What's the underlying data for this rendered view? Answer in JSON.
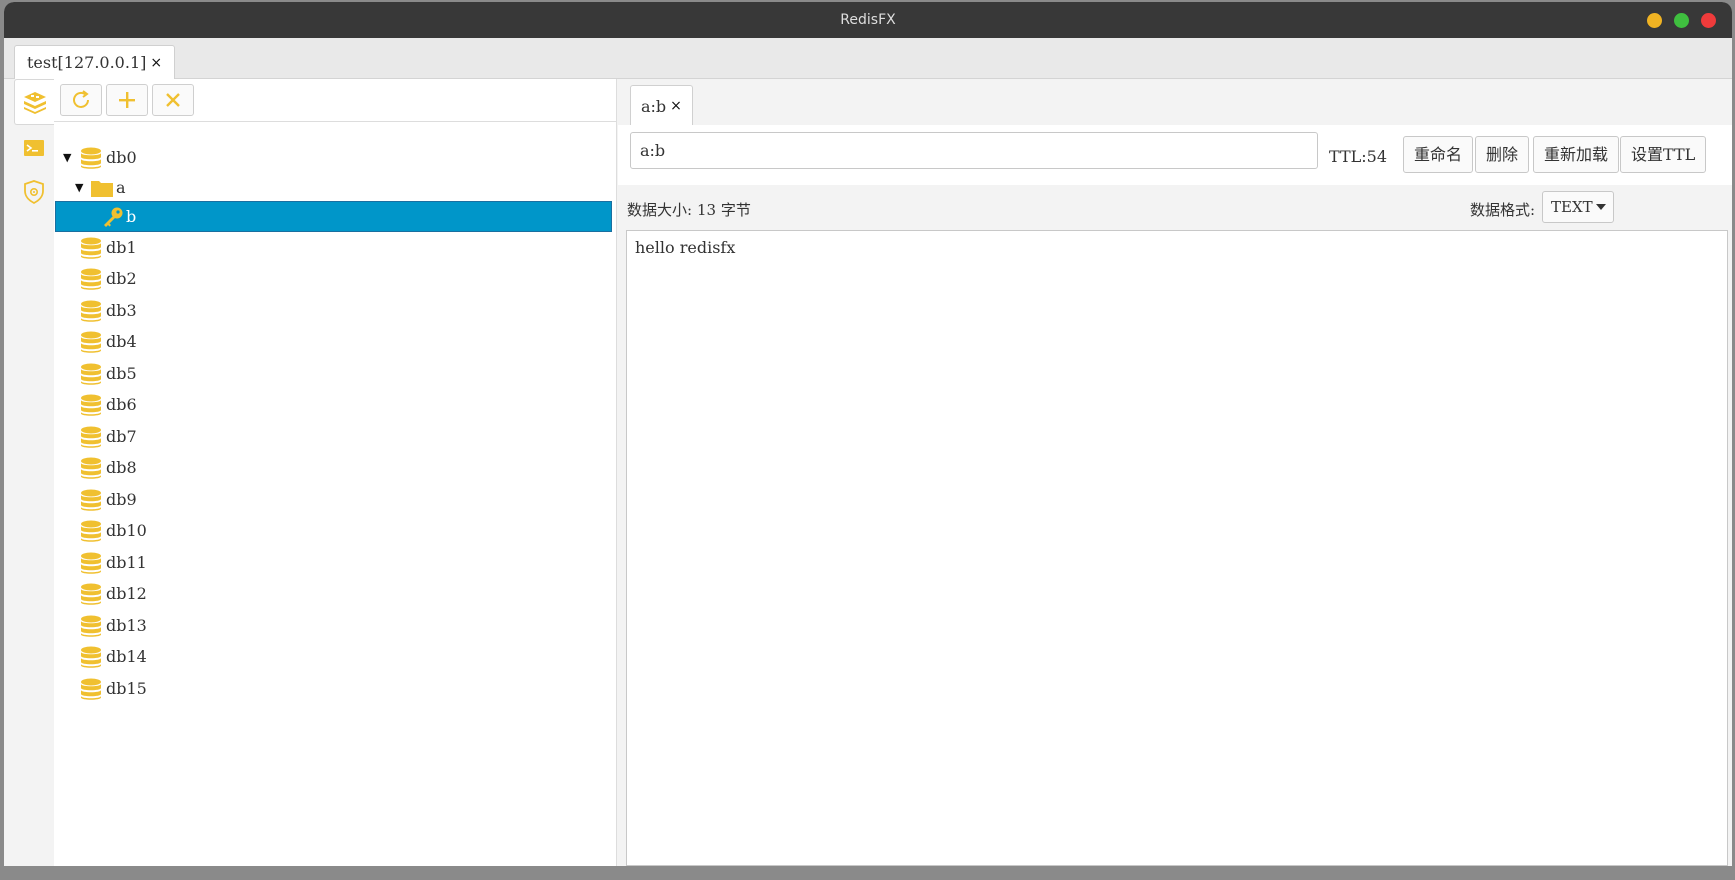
{
  "window": {
    "title": "RedisFX"
  },
  "connection_tab": {
    "label": "test[127.0.0.1]",
    "close": "×"
  },
  "colors": {
    "accent": "#f0c030",
    "selected": "#0096c9"
  },
  "tree": {
    "items": [
      {
        "label": "db0",
        "type": "db",
        "level": 0,
        "expanded": true
      },
      {
        "label": "a",
        "type": "folder",
        "level": 1,
        "expanded": true
      },
      {
        "label": "b",
        "type": "key",
        "level": 2,
        "selected": true
      },
      {
        "label": "db1",
        "type": "db",
        "level": 0
      },
      {
        "label": "db2",
        "type": "db",
        "level": 0
      },
      {
        "label": "db3",
        "type": "db",
        "level": 0
      },
      {
        "label": "db4",
        "type": "db",
        "level": 0
      },
      {
        "label": "db5",
        "type": "db",
        "level": 0
      },
      {
        "label": "db6",
        "type": "db",
        "level": 0
      },
      {
        "label": "db7",
        "type": "db",
        "level": 0
      },
      {
        "label": "db8",
        "type": "db",
        "level": 0
      },
      {
        "label": "db9",
        "type": "db",
        "level": 0
      },
      {
        "label": "db10",
        "type": "db",
        "level": 0
      },
      {
        "label": "db11",
        "type": "db",
        "level": 0
      },
      {
        "label": "db12",
        "type": "db",
        "level": 0
      },
      {
        "label": "db13",
        "type": "db",
        "level": 0
      },
      {
        "label": "db14",
        "type": "db",
        "level": 0
      },
      {
        "label": "db15",
        "type": "db",
        "level": 0
      }
    ]
  },
  "key_tab": {
    "label": "a:b",
    "close": "×"
  },
  "key": {
    "name": "a:b",
    "ttl": "TTL:54",
    "buttons": {
      "rename": "重命名",
      "delete": "删除",
      "reload": "重新加载",
      "set_ttl": "设置TTL"
    },
    "size_label": "数据大小:",
    "size_value": "13 字节",
    "format_label": "数据格式:",
    "format_value": "TEXT",
    "value": "hello redisfx"
  }
}
